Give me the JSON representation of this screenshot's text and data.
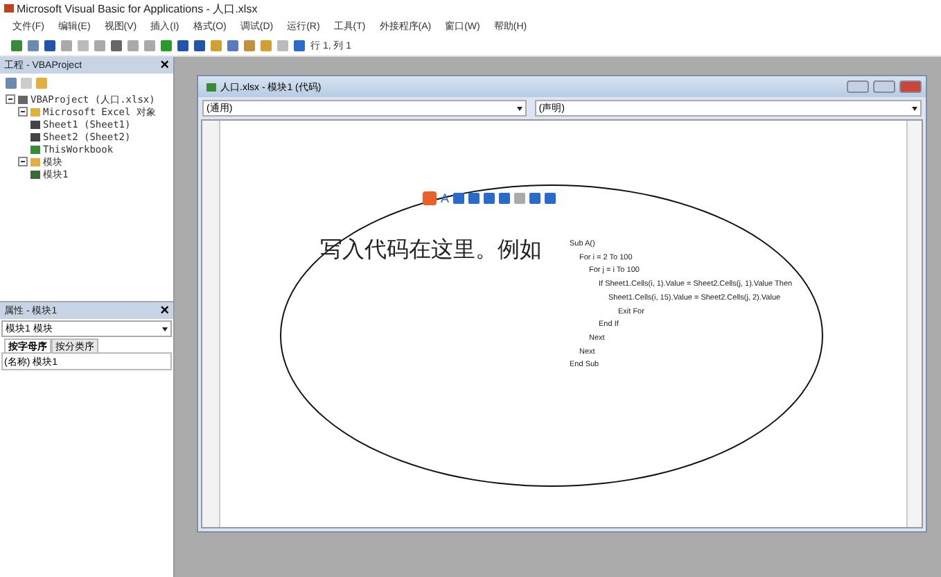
{
  "window": {
    "title": "Microsoft Visual Basic for Applications - 人口.xlsx"
  },
  "menu": [
    "文件(F)",
    "编辑(E)",
    "视图(V)",
    "插入(I)",
    "格式(O)",
    "调试(D)",
    "运行(R)",
    "工具(T)",
    "外接程序(A)",
    "窗口(W)",
    "帮助(H)"
  ],
  "toolbar": {
    "position": "行 1, 列 1"
  },
  "project_panel": {
    "title": "工程 - VBAProject",
    "close": "×",
    "tree": [
      {
        "label": "VBAProject (人口.xlsx)",
        "kind": "project",
        "expanded": true,
        "children": [
          {
            "label": "Microsoft Excel 对象",
            "kind": "folder",
            "expanded": true,
            "children": [
              {
                "label": "Sheet1 (Sheet1)",
                "kind": "sheet"
              },
              {
                "label": "Sheet2 (Sheet2)",
                "kind": "sheet"
              },
              {
                "label": "ThisWorkbook",
                "kind": "workbook"
              }
            ]
          },
          {
            "label": "模块",
            "kind": "folder",
            "expanded": true,
            "children": [
              {
                "label": "模块1",
                "kind": "module"
              }
            ]
          }
        ]
      }
    ]
  },
  "properties_panel": {
    "title": "属性 - 模块1",
    "close": "×",
    "object": "模块1 模块",
    "tabs": [
      {
        "label": "按字母序",
        "selected": true
      },
      {
        "label": "按分类序",
        "selected": false
      }
    ],
    "rows": [
      {
        "name": "(名称)",
        "value": "模块1"
      }
    ]
  },
  "code_window": {
    "title": "人口.xlsx - 模块1 (代码)",
    "object_dropdown": "(通用)",
    "procedure_dropdown": "(声明)",
    "annotation": {
      "ime_label": "A",
      "text": "写入代码在这里。例如",
      "code": [
        {
          "text": "Sub A()",
          "children": [
            {
              "text": "For i = 2 To 100",
              "children": [
                {
                  "text": "For j = i To 100",
                  "children": [
                    {
                      "text": "If Sheet1.Cells(i, 1).Value = Sheet2.Cells(j, 1).Value Then",
                      "children": [
                        {
                          "text": "Sheet1.Cells(i, 15).Value = Sheet2.Cells(j, 2).Value",
                          "children": [
                            {
                              "text": "Exit For"
                            }
                          ]
                        }
                      ]
                    },
                    {
                      "text": "End If"
                    }
                  ]
                },
                {
                  "text": "Next"
                }
              ]
            },
            {
              "text": "Next"
            }
          ]
        },
        {
          "text": "End Sub"
        }
      ]
    }
  }
}
